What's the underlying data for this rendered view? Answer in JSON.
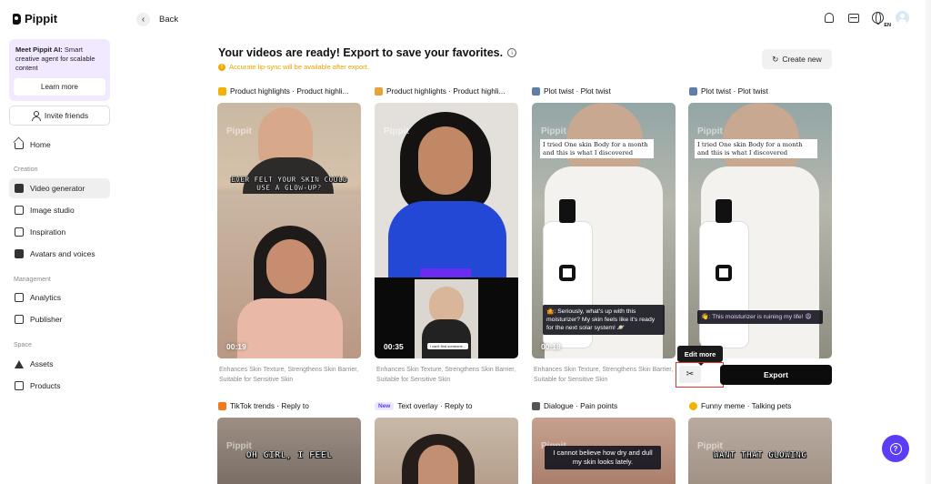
{
  "app": {
    "name": "Pippit"
  },
  "sidebar": {
    "promo": {
      "title": "Meet Pippit AI:",
      "text": "Smart creative agent for scalable content",
      "button": "Learn more"
    },
    "invite": "Invite friends",
    "home": "Home",
    "sections": {
      "creation": "Creation",
      "management": "Management",
      "space": "Space"
    },
    "creation_items": [
      "Video generator",
      "Image studio",
      "Inspiration",
      "Avatars and voices"
    ],
    "management_items": [
      "Analytics",
      "Publisher"
    ],
    "space_items": [
      "Assets",
      "Products"
    ],
    "active_item": "Video generator"
  },
  "topbar": {
    "back": "Back",
    "language": "EN"
  },
  "header": {
    "title": "Your videos are ready! Export to save your favorites.",
    "warning": "Accurate lip-sync will be available after export.",
    "create_new": "Create new"
  },
  "cards": [
    {
      "label": "Product highlights · Product highli...",
      "duration": "00:19",
      "meme": "EVER FELT YOUR SKIN COULD USE A GLOW-UP?",
      "description": "Enhances Skin Texture, Strengthens Skin Barrier, Suitable for Sensitive Skin",
      "emoji_color": "#f2b300"
    },
    {
      "label": "Product highlights · Product highli...",
      "duration": "00:35",
      "mini_caption": "I can't find someone...",
      "description": "Enhances Skin Texture, Strengthens Skin Barrier, Suitable for Sensitive Skin",
      "emoji_color": "#e7a43a"
    },
    {
      "label": "Plot twist · Plot twist",
      "duration": "00:18",
      "top_caption": "I tried One skin Body for a month and this is what I discovered",
      "bubble": "🤷: Seriously, what's up with this moisturizer? My skin feels like it's ready for the next solar system! 🪐",
      "description": "Enhances Skin Texture, Strengthens Skin Barrier, Suitable for Sensitive Skin",
      "emoji_color": "#5f7fa8"
    },
    {
      "label": "Plot twist · Plot twist",
      "top_caption": "I tried One skin Body for a month and this is what I discovered",
      "bubble": "👋: This moisturizer is ruining my life! 😩",
      "emoji_color": "#5f7fa8"
    }
  ],
  "card_actions": {
    "edit_more": "Edit more",
    "export": "Export"
  },
  "bottom_cards": [
    {
      "label": "TikTok trends · Reply to",
      "meme": "OH GIRL, I FEEL",
      "emoji_color": "#f07b1e"
    },
    {
      "badge": "New",
      "label": "Text overlay · Reply to"
    },
    {
      "label": "Dialogue · Pain points",
      "caption": "I cannot believe how dry and dull my skin looks lately.",
      "emoji_color": "#555555"
    },
    {
      "label": "Funny meme · Talking pets",
      "meme": "WANT THAT GLOWING",
      "emoji_color": "#f2b300"
    }
  ],
  "colors": {
    "accent": "#5b3df5",
    "warning": "#e8a300",
    "highlight_box": "#e6322b"
  }
}
